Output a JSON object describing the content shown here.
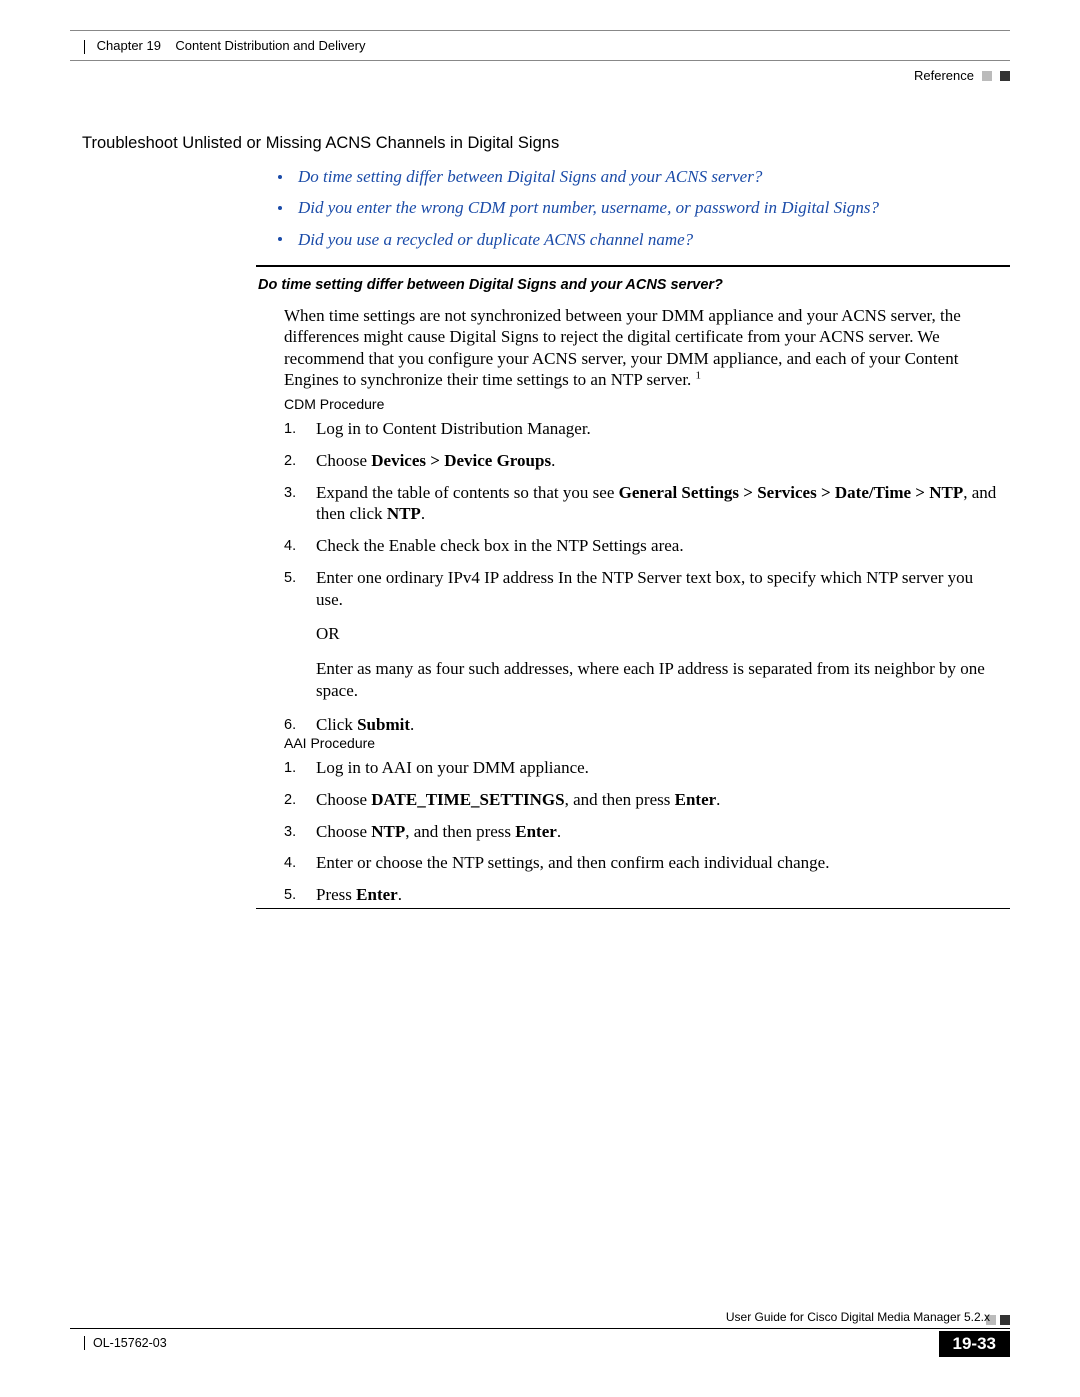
{
  "header": {
    "chapter": "Chapter 19",
    "title": "Content Distribution and Delivery",
    "section": "Reference"
  },
  "page": {
    "heading": "Troubleshoot Unlisted or Missing ACNS Channels in Digital Signs",
    "links": [
      "Do time setting differ between Digital Signs and your ACNS server?",
      "Did you enter the wrong CDM port number, username, or password in Digital Signs?",
      "Did you use a recycled or duplicate ACNS channel name?"
    ],
    "qheading": "Do time setting differ between Digital Signs and your ACNS server?",
    "body": "When time settings are not synchronized between your DMM appliance and your ACNS server, the differences might cause Digital Signs to reject the digital certificate from your ACNS server. We recommend that you configure your ACNS server, your DMM appliance, and each of your Content Engines to synchronize their time settings to an NTP server.",
    "footnote_marker": "1",
    "cdm": {
      "label": "CDM Procedure",
      "s1": "Log in to Content Distribution Manager.",
      "s2_pre": "Choose ",
      "s2_bold": "Devices > Device Groups",
      "s2_post": ".",
      "s3_pre": "Expand the table of contents so that you see ",
      "s3_b1": "General Settings > Services > Date/Time > NTP",
      "s3_mid": ", and then click ",
      "s3_b2": "NTP",
      "s3_post": ".",
      "s4": "Check the Enable check box in the NTP Settings area.",
      "s5": "Enter one ordinary IPv4 IP address In the NTP Server text box, to specify which NTP server you use.",
      "or": "OR",
      "after_or": "Enter as many as four such addresses, where each IP address is separated from its neighbor by one space.",
      "s6_pre": "Click ",
      "s6_bold": "Submit",
      "s6_post": "."
    },
    "aai": {
      "label": "AAI Procedure",
      "s1": "Log in to AAI on your DMM appliance.",
      "s2_pre": "Choose ",
      "s2_b1": "DATE_TIME_SETTINGS",
      "s2_mid": ", and then press ",
      "s2_b2": "Enter",
      "s2_post": ".",
      "s3_pre": "Choose ",
      "s3_b1": "NTP",
      "s3_mid": ", and then press ",
      "s3_b2": "Enter",
      "s3_post": ".",
      "s4": "Enter or choose the NTP settings, and then confirm each individual change.",
      "s5_pre": "Press ",
      "s5_bold": "Enter",
      "s5_post": "."
    }
  },
  "footer": {
    "book": "User Guide for Cisco Digital Media Manager 5.2.x",
    "docid": "OL-15762-03",
    "pagenum": "19-33"
  },
  "nums": {
    "n1": "1.",
    "n2": "2.",
    "n3": "3.",
    "n4": "4.",
    "n5": "5.",
    "n6": "6."
  }
}
